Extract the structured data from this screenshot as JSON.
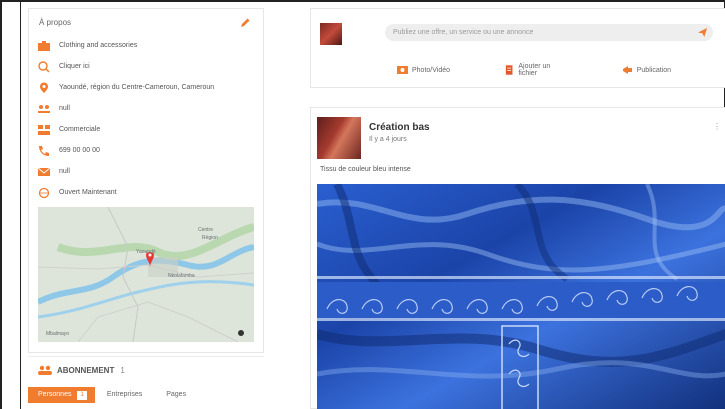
{
  "about": {
    "title": "À propos",
    "items": [
      {
        "icon": "briefcase-icon",
        "text": "Clothing and accessories"
      },
      {
        "icon": "search-icon",
        "text": "Cliquer ici"
      },
      {
        "icon": "location-pin-icon",
        "text": "Yaoundé, région du Centre-Cameroun, Cameroun"
      },
      {
        "icon": "people-icon",
        "text": "null"
      },
      {
        "icon": "group-icon",
        "text": "Commerciale"
      },
      {
        "icon": "phone-icon",
        "text": "699 00 00 00"
      },
      {
        "icon": "mail-icon",
        "text": "null"
      },
      {
        "icon": "globe-icon",
        "text": "Ouvert Maintenant"
      }
    ],
    "map": {
      "labels": [
        "Centre",
        "Région",
        "Yaoundé",
        "Nkolafamba",
        "Mbalmayo"
      ]
    }
  },
  "subscribers": {
    "title": "ABONNEMENT",
    "count": "1",
    "tabs": [
      {
        "label": "Personnes",
        "badge": "1",
        "active": true
      },
      {
        "label": "Entreprises",
        "badge": "",
        "active": false
      },
      {
        "label": "Pages",
        "badge": "",
        "active": false
      }
    ]
  },
  "composer": {
    "placeholder": "Publiez une offre, un service ou une annonce",
    "actions": [
      {
        "icon": "photo-icon",
        "label": "Photo/Vidéo"
      },
      {
        "icon": "document-icon",
        "label": "Ajouter un fichier"
      },
      {
        "icon": "megaphone-icon",
        "label": "Publication"
      }
    ]
  },
  "post": {
    "author": "Création bas",
    "subtitle": "Il y a 4 jours",
    "caption": "Tissu de couleur bleu intense",
    "menu": "⋮"
  },
  "colors": {
    "accent": "#f07c30",
    "fabric": "#1f4fb6"
  }
}
